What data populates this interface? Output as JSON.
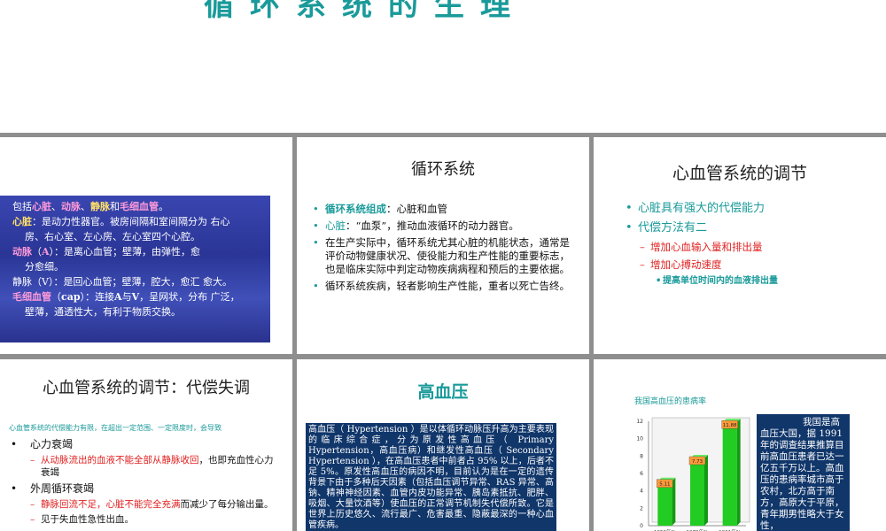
{
  "top": {
    "title": "循环系统的生理"
  },
  "slide1": {
    "lines": [
      {
        "parts": [
          {
            "t": "包括",
            "c": "w"
          },
          {
            "t": "心脏",
            "c": "pink"
          },
          {
            "t": "、",
            "c": "w"
          },
          {
            "t": "动脉",
            "c": "pink"
          },
          {
            "t": "、",
            "c": "w"
          },
          {
            "t": "静脉",
            "c": "yellow"
          },
          {
            "t": "和",
            "c": "w"
          },
          {
            "t": "毛细血管",
            "c": "pink"
          },
          {
            "t": "。",
            "c": "w"
          }
        ]
      },
      {
        "parts": [
          {
            "t": "心脏",
            "c": "yellow"
          },
          {
            "t": "：是动力性器官。被房间隔和室间隔分为 右心",
            "c": "w"
          }
        ]
      },
      {
        "indent": true,
        "parts": [
          {
            "t": "房、右心室、左心房、左心室四个心腔。",
            "c": "w"
          }
        ]
      },
      {
        "parts": [
          {
            "t": "动脉",
            "c": "pink"
          },
          {
            "t": "（",
            "c": "w"
          },
          {
            "t": "A",
            "c": "pink"
          },
          {
            "t": "）：是离心血管；壁薄，由弹性，愈",
            "c": "w"
          }
        ]
      },
      {
        "indent": true,
        "parts": [
          {
            "t": "分愈细。",
            "c": "w"
          }
        ]
      },
      {
        "parts": [
          {
            "t": "静脉（V）：是回心血管；壁薄，腔大，愈汇 愈大。",
            "c": "w"
          }
        ]
      },
      {
        "parts": [
          {
            "t": "毛细血管",
            "c": "pink"
          },
          {
            "t": "（",
            "c": "w"
          },
          {
            "t": "cap",
            "c": "bw"
          },
          {
            "t": "）：连接",
            "c": "w"
          },
          {
            "t": "A",
            "c": "bw"
          },
          {
            "t": "与",
            "c": "w"
          },
          {
            "t": "V",
            "c": "bw"
          },
          {
            "t": "，呈网状，分布 广泛，",
            "c": "w"
          }
        ]
      },
      {
        "indent": true,
        "parts": [
          {
            "t": "壁薄，通透性大，有利于物质交换。",
            "c": "w"
          }
        ]
      }
    ]
  },
  "slide2": {
    "title": "循环系统",
    "b1_label": "循环系统组成",
    "b1_text": "：心脏和血管",
    "b2_label": "心脏",
    "b2_text": "：“血泵”，推动血液循环的动力器官。",
    "b3": "在生产实际中，循环系统尤其心脏的机能状态，通常是评价动物健康状况、使役能力和生产性能的重要标志，也是临床实际中判定动物疾病病程和预后的主要依据。",
    "b4": "循环系统疾病，轻者影响生产性能，重者以死亡告终。"
  },
  "slide3": {
    "title": "心血管系统的调节",
    "l1": "心脏具有强大的代偿能力",
    "l2": "代偿方法有二",
    "l3a": "增加心血输入量和排出量",
    "l3b": "增加心搏动速度",
    "l4": "提高单位时间内的血液排出量"
  },
  "slide4": {
    "title": "心血管系统的调节：代偿失调",
    "intro": "心血管系统的代偿能力有限，在超出一定范围、一定限度时，会导致",
    "b1": "心力衰竭",
    "b1s_red": "从动脉流出的血液不能全部从静脉收回",
    "b1s_rest": "，也即充血性心力衰竭",
    "b2": "外周循环衰竭",
    "b2s_red": "静脉回流不足，心脏不能完全充满",
    "b2s_rest": "而减少了每分输出量。",
    "b3s": "见于失血性急性出血。"
  },
  "slide5": {
    "title": "高血压",
    "text": "高血压（ Hypertension ）是以体循环动脉压升高为主要表现的临床综合症，分为原发性高血压（ Primary Hypertension，高血压病）和继发性高血压（ Secondary Hypertension ），在高血压患者中前者占 95% 以上，后者不足 5%。原发性高血压的病因不明，目前认为是在一定的遗传背景下由于多种后天因素（包括血压调节异常、RAS 异常、高钠、精神神经因素、血管内皮功能异常、胰岛素抵抗、肥胖、吸烟、大量饮酒等）使血压的正常调节机制失代偿所致。它是世界上历史悠久、流行最广、危害最重、隐蔽最深的一种心血管疾病。"
  },
  "slide6": {
    "box_text_first": "我国是高",
    "box_text": "血压大国，据 1991 年的调查结果推算目前高血压患者已达一亿五千万以上。高血压的患病率城市高于农村，北方高于南方，高原大于平原，青年期男性略大于女性，"
  },
  "chart_data": {
    "type": "bar",
    "title": "我国高血压的患病率",
    "categories": [
      "1959年%",
      "1979年%",
      "1991年%"
    ],
    "values": [
      5.11,
      7.73,
      11.88
    ],
    "value_labels": [
      "5.11",
      "7.73",
      "11.88"
    ],
    "ylim": [
      0,
      12
    ],
    "yticks": [
      0,
      2,
      4,
      6,
      8,
      10,
      12
    ],
    "grid": false,
    "bar_color": "#22cc22",
    "label_color": "#ff9a3a"
  }
}
